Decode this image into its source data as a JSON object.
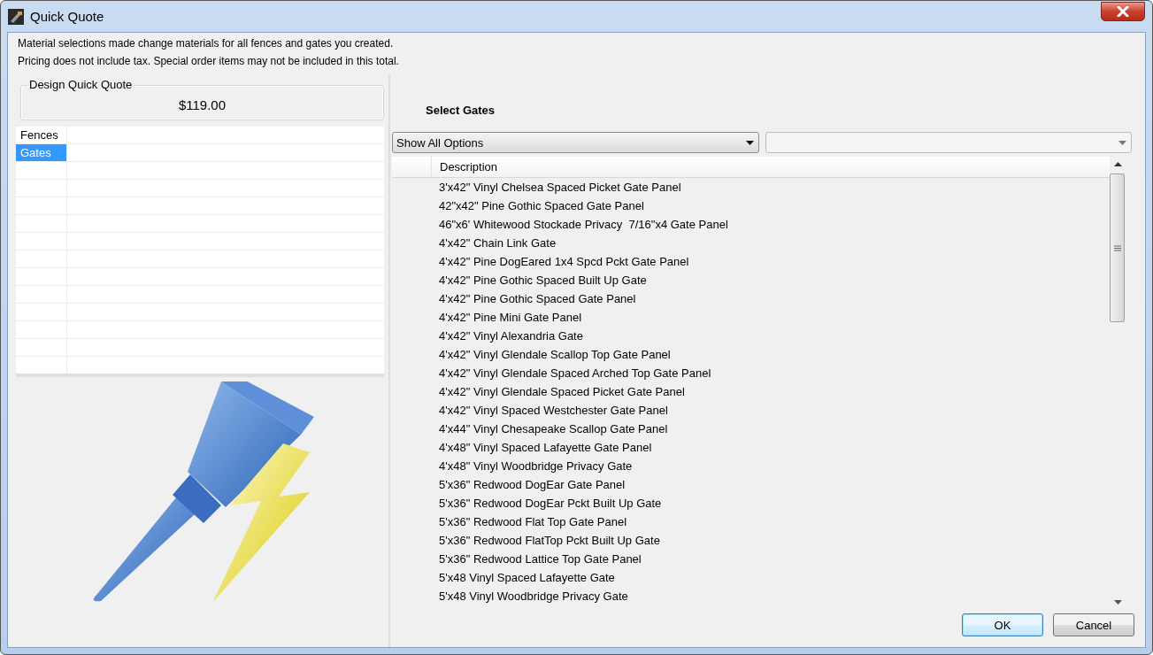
{
  "window": {
    "title": "Quick Quote"
  },
  "notes": [
    "Material selections made change materials for all fences and gates you created.",
    "Pricing does not include tax. Special order items may not be included in this total."
  ],
  "quote": {
    "label": "Design Quick Quote",
    "total": "$119.00"
  },
  "categories": [
    {
      "label": "Fences",
      "selected": false
    },
    {
      "label": "Gates",
      "selected": true
    }
  ],
  "section_title": "Select Gates",
  "filter": {
    "value": "Show All Options"
  },
  "table": {
    "columns": [
      "Description"
    ],
    "rows": [
      "3'x42\" Vinyl Chelsea Spaced Picket Gate Panel",
      "42\"x42\" Pine Gothic Spaced Gate Panel",
      "46\"x6' Whitewood Stockade Privacy  7/16\"x4 Gate Panel",
      "4'x42\" Chain Link Gate",
      "4'x42\" Pine DogEared 1x4 Spcd Pckt Gate Panel",
      "4'x42\" Pine Gothic Spaced Built Up Gate",
      "4'x42\" Pine Gothic Spaced Gate Panel",
      "4'x42\" Pine Mini Gate Panel",
      "4'x42\" Vinyl Alexandria Gate",
      "4'x42\" Vinyl Glendale Scallop Top Gate Panel",
      "4'x42\" Vinyl Glendale Spaced Arched Top Gate Panel",
      "4'x42\" Vinyl Glendale Spaced Picket Gate Panel",
      "4'x42\" Vinyl Spaced Westchester Gate Panel",
      "4'x44\" Vinyl Chesapeake Scallop Gate Panel",
      "4'x48\" Vinyl Spaced Lafayette Gate Panel",
      "4'x48\" Vinyl Woodbridge Privacy Gate",
      "5'x36\" Redwood DogEar Gate Panel",
      "5'x36\" Redwood DogEar Pckt Built Up Gate",
      "5'x36\" Redwood Flat Top Gate Panel",
      "5'x36\" Redwood FlatTop Pckt Built Up Gate",
      "5'x36\" Redwood Lattice Top Gate Panel",
      "5'x48 Vinyl Spaced Lafayette Gate",
      "5'x48 Vinyl Woodbridge Privacy Gate"
    ]
  },
  "buttons": [
    {
      "label": "OK",
      "kind": "default"
    },
    {
      "label": "Cancel",
      "kind": "normal"
    }
  ]
}
